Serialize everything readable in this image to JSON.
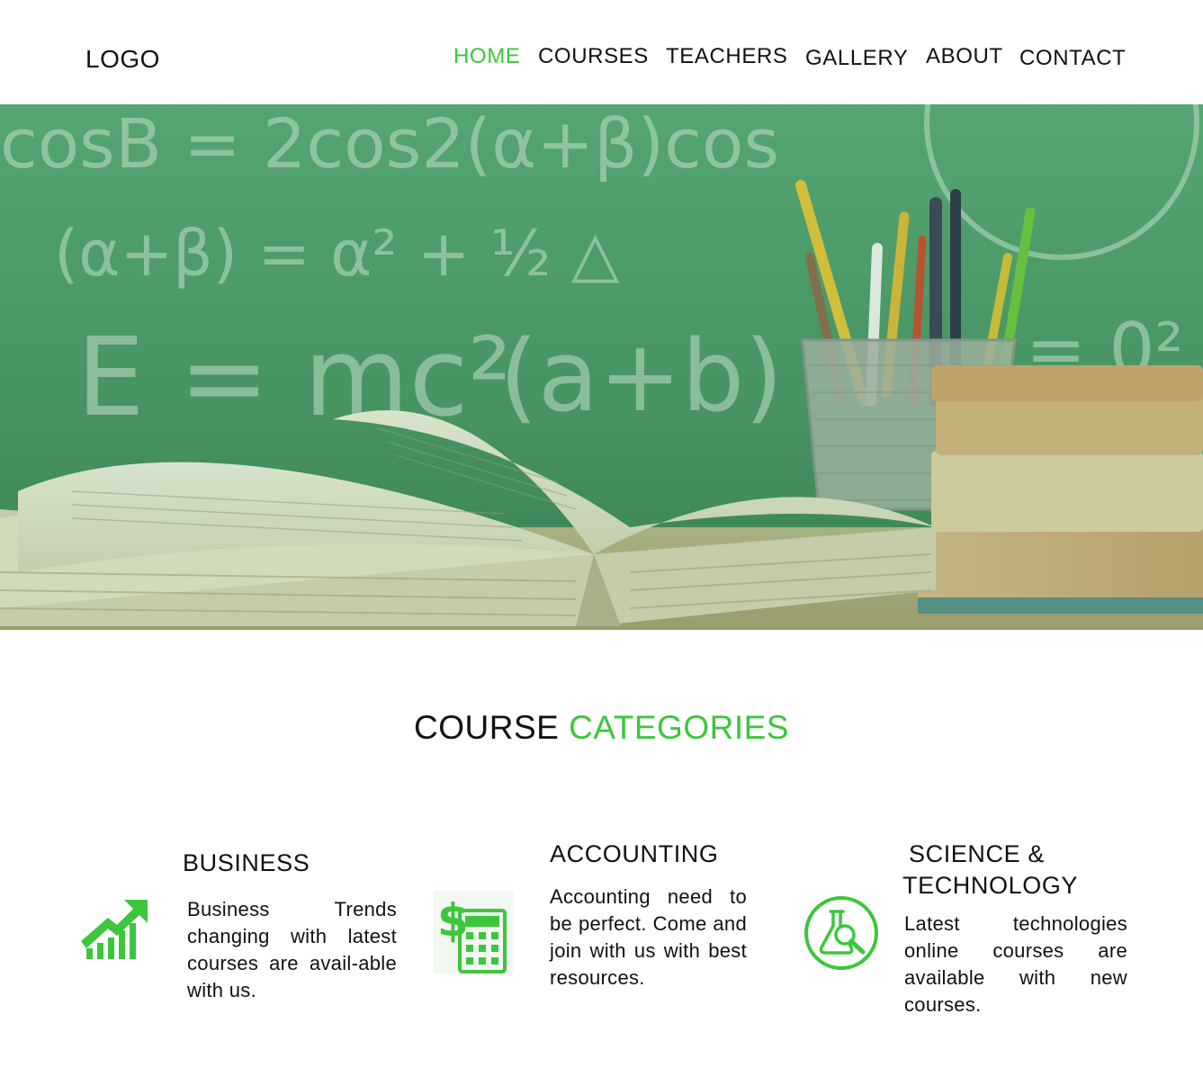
{
  "header": {
    "logo": "LOGO",
    "nav": [
      {
        "label": "HOME",
        "active": true
      },
      {
        "label": "COURSES",
        "active": false
      },
      {
        "label": "TEACHERS",
        "active": false
      },
      {
        "label": "GALLERY",
        "active": false
      },
      {
        "label": "ABOUT",
        "active": false
      },
      {
        "label": "CONTACT",
        "active": false
      }
    ]
  },
  "hero": {
    "chalk": {
      "line1": "cosB = 2cos2(α+β)cos",
      "line2": "(α+β) = α² + ½ △",
      "line3": "E = mc²",
      "line4": "(a+b)",
      "line5": "= 0²"
    }
  },
  "section": {
    "title_plain": "COURSE",
    "title_accent": "CATEGORIES"
  },
  "categories": [
    {
      "icon": "growth-chart-icon",
      "title": "BUSINESS",
      "description": "Business Trends changing with latest courses are avail-able with us."
    },
    {
      "icon": "calculator-icon",
      "title": "ACCOUNTING",
      "description": "Accounting need to be perfect. Come and join with us with best resources."
    },
    {
      "icon": "science-flask-icon",
      "title_line1": "SCIENCE &",
      "title_line2": "TECHNOLOGY",
      "description": "Latest technologies online courses are available with new courses."
    }
  ],
  "colors": {
    "accent": "#3cc63c",
    "text": "#111111",
    "chalkboard": "#4e9a6a"
  }
}
